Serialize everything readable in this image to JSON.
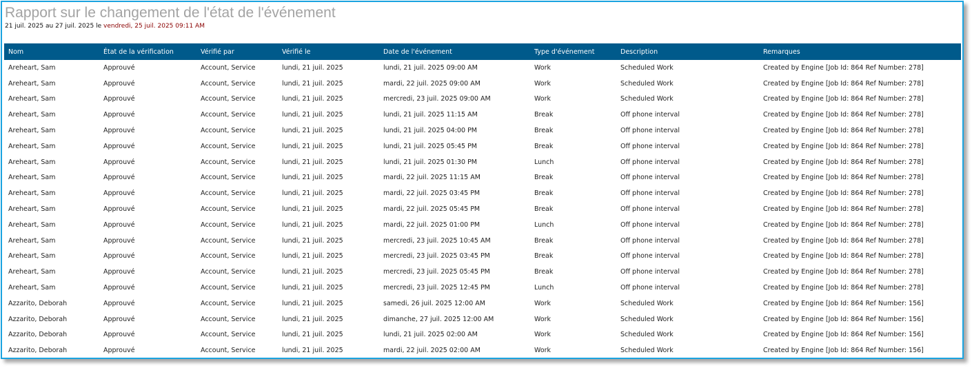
{
  "report": {
    "title": "Rapport sur le changement de l'état de l'événement",
    "range_text": "21 juil. 2025 au 27 juil. 2025 le ",
    "generated_at": "vendredi, 25 juil. 2025 09:11 AM",
    "accent_color": "#8a0000",
    "header_color": "#005a8b",
    "frame_color": "#1aa3e0"
  },
  "table": {
    "columns": [
      "Nom",
      "État de la vérification",
      "Vérifié par",
      "Vérifié le",
      "Date de l'événement",
      "Type d'événement",
      "Description",
      "Remarques"
    ],
    "rows": [
      [
        "Areheart, Sam",
        "Approuvé",
        "Account, Service",
        "lundi, 21 juil. 2025",
        "lundi, 21 juil. 2025 09:00 AM",
        "Work",
        "Scheduled Work",
        "Created by Engine [Job Id: 864 Ref Number: 278]"
      ],
      [
        "Areheart, Sam",
        "Approuvé",
        "Account, Service",
        "lundi, 21 juil. 2025",
        "mardi, 22 juil. 2025 09:00 AM",
        "Work",
        "Scheduled Work",
        "Created by Engine [Job Id: 864 Ref Number: 278]"
      ],
      [
        "Areheart, Sam",
        "Approuvé",
        "Account, Service",
        "lundi, 21 juil. 2025",
        "mercredi, 23 juil. 2025 09:00 AM",
        "Work",
        "Scheduled Work",
        "Created by Engine [Job Id: 864 Ref Number: 278]"
      ],
      [
        "Areheart, Sam",
        "Approuvé",
        "Account, Service",
        "lundi, 21 juil. 2025",
        "lundi, 21 juil. 2025 11:15 AM",
        "Break",
        "Off phone interval",
        "Created by Engine [Job Id: 864 Ref Number: 278]"
      ],
      [
        "Areheart, Sam",
        "Approuvé",
        "Account, Service",
        "lundi, 21 juil. 2025",
        "lundi, 21 juil. 2025 04:00 PM",
        "Break",
        "Off phone interval",
        "Created by Engine [Job Id: 864 Ref Number: 278]"
      ],
      [
        "Areheart, Sam",
        "Approuvé",
        "Account, Service",
        "lundi, 21 juil. 2025",
        "lundi, 21 juil. 2025 05:45 PM",
        "Break",
        "Off phone interval",
        "Created by Engine [Job Id: 864 Ref Number: 278]"
      ],
      [
        "Areheart, Sam",
        "Approuvé",
        "Account, Service",
        "lundi, 21 juil. 2025",
        "lundi, 21 juil. 2025 01:30 PM",
        "Lunch",
        "Off phone interval",
        "Created by Engine [Job Id: 864 Ref Number: 278]"
      ],
      [
        "Areheart, Sam",
        "Approuvé",
        "Account, Service",
        "lundi, 21 juil. 2025",
        "mardi, 22 juil. 2025 11:15 AM",
        "Break",
        "Off phone interval",
        "Created by Engine [Job Id: 864 Ref Number: 278]"
      ],
      [
        "Areheart, Sam",
        "Approuvé",
        "Account, Service",
        "lundi, 21 juil. 2025",
        "mardi, 22 juil. 2025 03:45 PM",
        "Break",
        "Off phone interval",
        "Created by Engine [Job Id: 864 Ref Number: 278]"
      ],
      [
        "Areheart, Sam",
        "Approuvé",
        "Account, Service",
        "lundi, 21 juil. 2025",
        "mardi, 22 juil. 2025 05:45 PM",
        "Break",
        "Off phone interval",
        "Created by Engine [Job Id: 864 Ref Number: 278]"
      ],
      [
        "Areheart, Sam",
        "Approuvé",
        "Account, Service",
        "lundi, 21 juil. 2025",
        "mardi, 22 juil. 2025 01:00 PM",
        "Lunch",
        "Off phone interval",
        "Created by Engine [Job Id: 864 Ref Number: 278]"
      ],
      [
        "Areheart, Sam",
        "Approuvé",
        "Account, Service",
        "lundi, 21 juil. 2025",
        "mercredi, 23 juil. 2025 10:45 AM",
        "Break",
        "Off phone interval",
        "Created by Engine [Job Id: 864 Ref Number: 278]"
      ],
      [
        "Areheart, Sam",
        "Approuvé",
        "Account, Service",
        "lundi, 21 juil. 2025",
        "mercredi, 23 juil. 2025 03:45 PM",
        "Break",
        "Off phone interval",
        "Created by Engine [Job Id: 864 Ref Number: 278]"
      ],
      [
        "Areheart, Sam",
        "Approuvé",
        "Account, Service",
        "lundi, 21 juil. 2025",
        "mercredi, 23 juil. 2025 05:45 PM",
        "Break",
        "Off phone interval",
        "Created by Engine [Job Id: 864 Ref Number: 278]"
      ],
      [
        "Areheart, Sam",
        "Approuvé",
        "Account, Service",
        "lundi, 21 juil. 2025",
        "mercredi, 23 juil. 2025 12:45 PM",
        "Lunch",
        "Off phone interval",
        "Created by Engine [Job Id: 864 Ref Number: 278]"
      ],
      [
        "Azzarito, Deborah",
        "Approuvé",
        "Account, Service",
        "lundi, 21 juil. 2025",
        "samedi, 26 juil. 2025 12:00 AM",
        "Work",
        "Scheduled Work",
        "Created by Engine [Job Id: 864 Ref Number: 156]"
      ],
      [
        "Azzarito, Deborah",
        "Approuvé",
        "Account, Service",
        "lundi, 21 juil. 2025",
        "dimanche, 27 juil. 2025 12:00 AM",
        "Work",
        "Scheduled Work",
        "Created by Engine [Job Id: 864 Ref Number: 156]"
      ],
      [
        "Azzarito, Deborah",
        "Approuvé",
        "Account, Service",
        "lundi, 21 juil. 2025",
        "lundi, 21 juil. 2025 02:00 AM",
        "Work",
        "Scheduled Work",
        "Created by Engine [Job Id: 864 Ref Number: 156]"
      ],
      [
        "Azzarito, Deborah",
        "Approuvé",
        "Account, Service",
        "lundi, 21 juil. 2025",
        "mardi, 22 juil. 2025 02:00 AM",
        "Work",
        "Scheduled Work",
        "Created by Engine [Job Id: 864 Ref Number: 156]"
      ]
    ]
  }
}
